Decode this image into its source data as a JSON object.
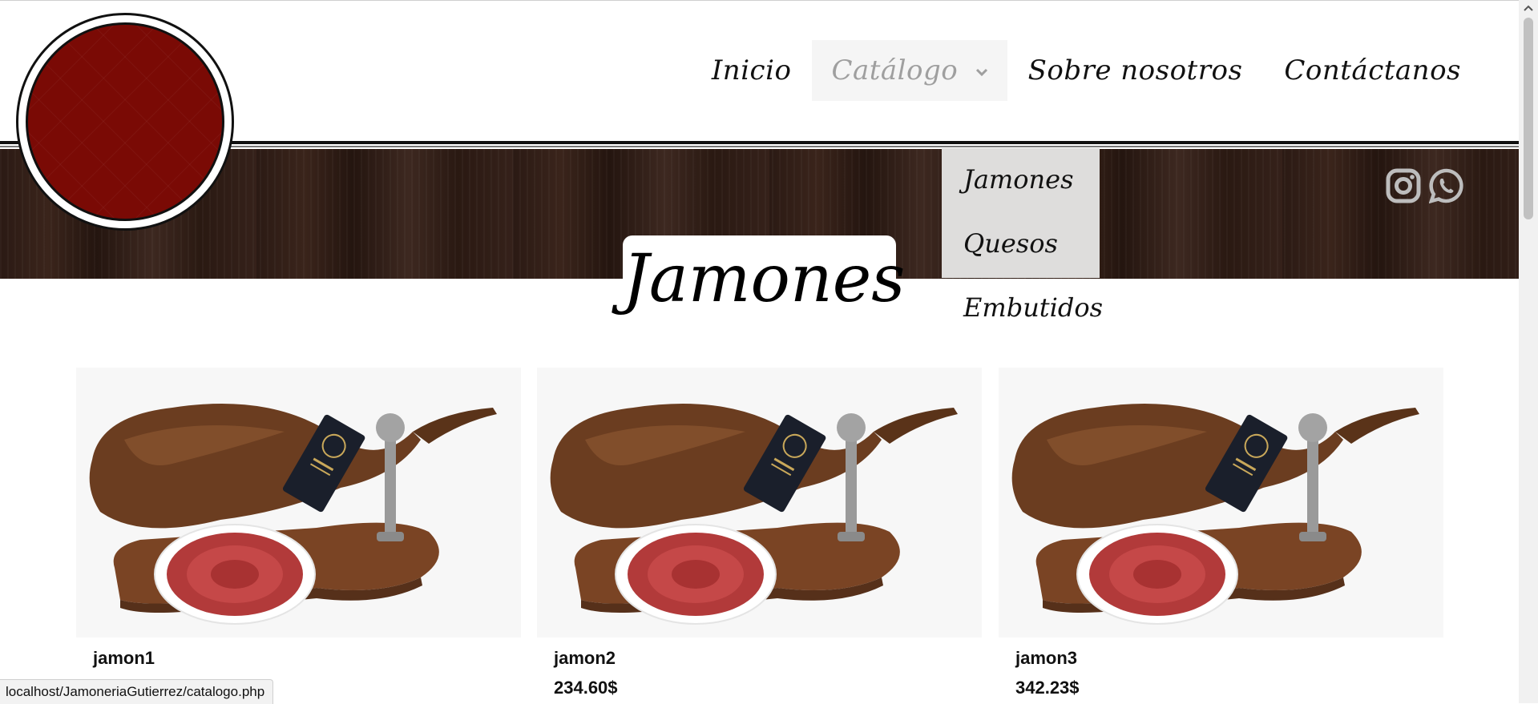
{
  "nav": {
    "items": [
      {
        "label": "Inicio",
        "active": false
      },
      {
        "label": "Catálogo",
        "active": true
      },
      {
        "label": "Sobre nosotros",
        "active": false
      },
      {
        "label": "Contáctanos",
        "active": false
      }
    ]
  },
  "dropdown": {
    "items": [
      "Jamones",
      "Quesos",
      "Embutidos"
    ]
  },
  "page": {
    "title": "Jamones"
  },
  "products": [
    {
      "name": "jamon1",
      "price": ""
    },
    {
      "name": "jamon2",
      "price": "234.60$"
    },
    {
      "name": "jamon3",
      "price": "342.23$"
    }
  ],
  "social": {
    "icons": [
      "instagram-icon",
      "whatsapp-icon"
    ]
  },
  "colors": {
    "logo_red": "#7a0a05",
    "wood": "#2b1a14",
    "dropdown_bg": "#dedddc"
  },
  "status_bar": {
    "url": "localhost/JamoneriaGutierrez/catalogo.php"
  }
}
